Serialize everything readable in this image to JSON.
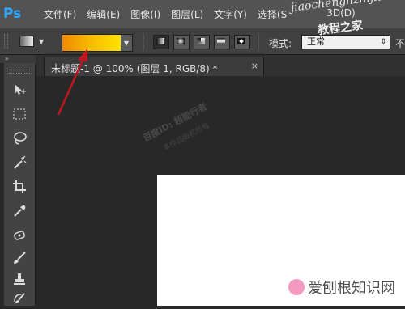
{
  "app": {
    "logo_text": "Ps"
  },
  "menu": [
    {
      "label": "文件(F)"
    },
    {
      "label": "编辑(E)"
    },
    {
      "label": "图像(I)"
    },
    {
      "label": "图层(L)"
    },
    {
      "label": "文字(Y)"
    },
    {
      "label": "选择(S"
    },
    {
      "label": "3D(D)"
    }
  ],
  "options": {
    "tool_preset_icon": "gradient-tool-preset-icon",
    "gradient_colors": [
      "#f08a00",
      "#f9c100",
      "#ffe300"
    ],
    "gradient_types": [
      "linear",
      "radial",
      "angle",
      "reflected",
      "diamond"
    ],
    "active_gradient_type": "linear",
    "mode_label": "模式:",
    "mode_value": "正常",
    "opacity_label": "不"
  },
  "document": {
    "tab_title": "未标题-1 @ 100% (图层 1, RGB/8) *",
    "close_glyph": "×"
  },
  "toolbar": {
    "collapse_glyph": "»",
    "tools": [
      "move-tool",
      "marquee-tool",
      "lasso-tool",
      "magic-wand-tool",
      "crop-tool",
      "eyedropper-tool",
      "healing-brush-tool",
      "brush-tool",
      "clone-stamp-tool",
      "history-brush-tool"
    ]
  },
  "watermarks": {
    "header_url": "jiaochenghzhijia.com",
    "header_cn": "教程之家",
    "canvas_line1": "百度ID: 超能行者",
    "canvas_line2": "本作品版权所有",
    "bottom": "爱刨根知识网"
  },
  "colors": {
    "canvas": "#ffffff",
    "workspace": "#282828",
    "arrow": "#c0171f"
  }
}
